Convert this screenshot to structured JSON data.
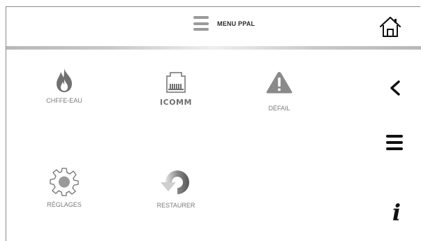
{
  "header": {
    "title": "MENU PPAL",
    "menu_icon": "hamburger-icon",
    "home_icon": "home-icon"
  },
  "tiles": [
    {
      "label": "CHFFE-EAU",
      "icon": "flame-icon"
    },
    {
      "label": "ICOMM",
      "icon": "network-port-icon"
    },
    {
      "label": "DÉFAIL",
      "icon": "warning-icon"
    },
    {
      "label": "RÉGLAGES",
      "icon": "gear-icon"
    },
    {
      "label": "RESTAURER",
      "icon": "restore-icon"
    }
  ],
  "side_nav": {
    "back_icon": "chevron-left-icon",
    "menu_icon": "hamburger-icon",
    "info_icon": "info-icon",
    "info_glyph": "i"
  },
  "colors": {
    "icon_gray": "#7a7a7a",
    "label_gray": "#7a7a7a",
    "nav_black": "#111111",
    "divider": "#c0c0c0"
  }
}
